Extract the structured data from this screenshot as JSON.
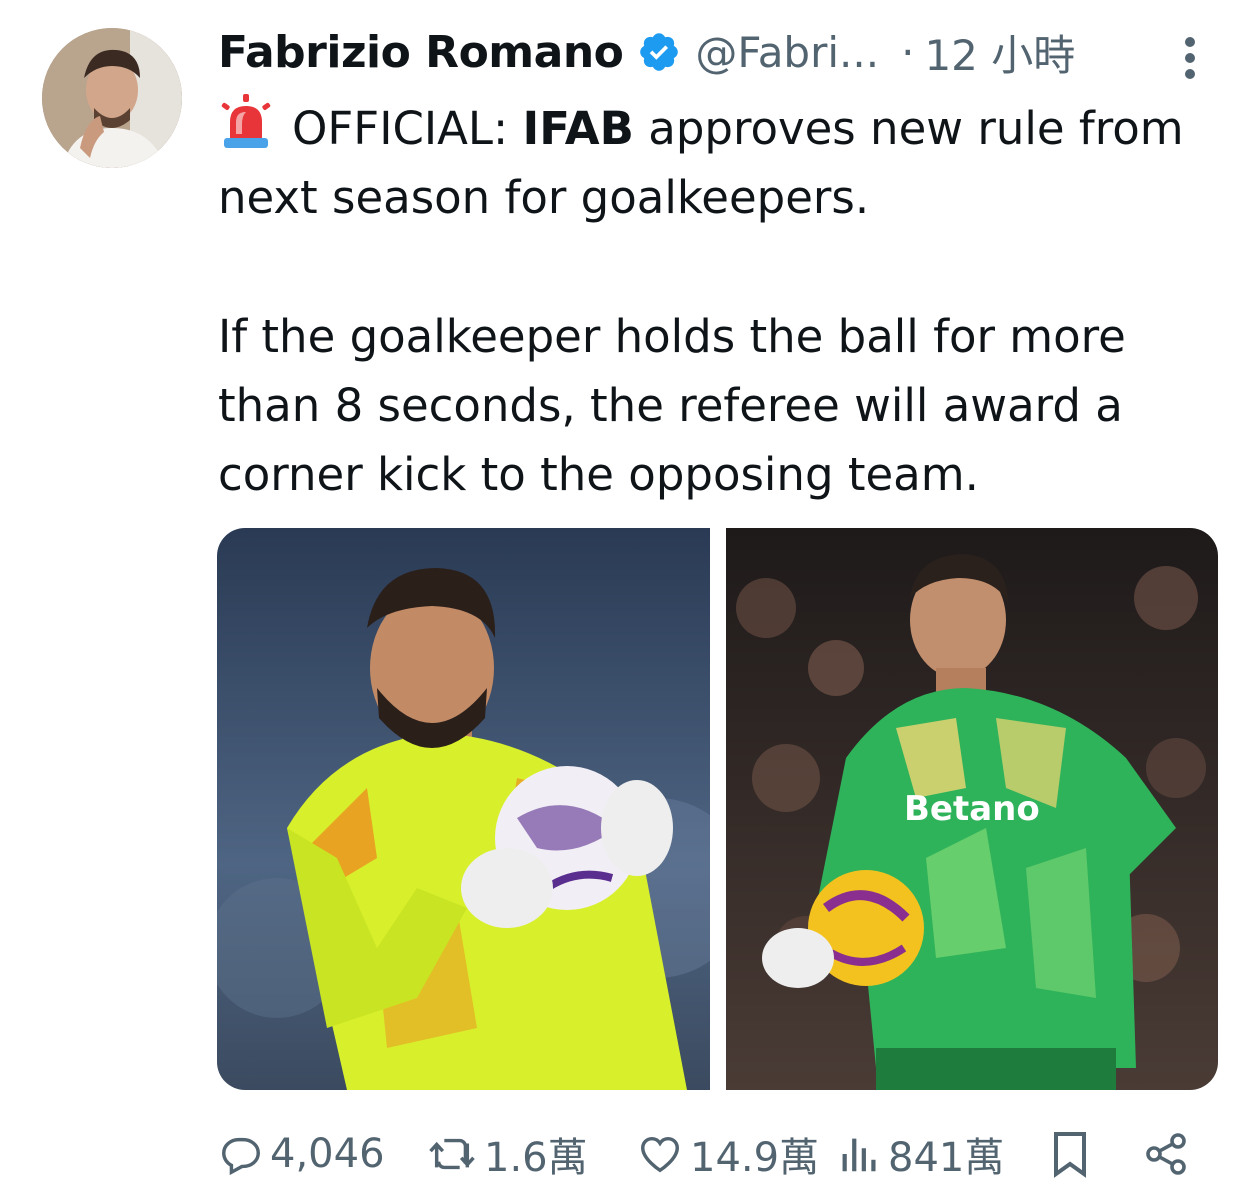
{
  "author": {
    "name": "Fabrizio Romano",
    "handle": "@Fabri...",
    "time_separator": "·",
    "time": "12 小時",
    "verified": true,
    "avatar_icon": "profile-photo"
  },
  "tweet": {
    "emoji": "siren-emoji",
    "line1_prefix": "OFFICIAL: ",
    "line1_bold": "IFAB",
    "line1_suffix": " approves new rule from next season for goalkeepers.",
    "paragraph2": "If the goalkeeper holds the ball for more than 8 seconds, the referee will award a corner kick to the opposing team."
  },
  "media": [
    {
      "subject": "goalkeeper-in-yellow-kit-holding-ball",
      "kit_color": "#d8f02c"
    },
    {
      "subject": "goalkeeper-in-green-kit-holding-ball",
      "kit_color": "#2fb35a",
      "sponsor_text": "Betano"
    }
  ],
  "actions": {
    "reply": {
      "icon": "reply-icon",
      "count": "4,046"
    },
    "repost": {
      "icon": "repost-icon",
      "count": "1.6萬"
    },
    "like": {
      "icon": "heart-icon",
      "count": "14.9萬"
    },
    "views": {
      "icon": "views-icon",
      "count": "841萬"
    },
    "bookmark": {
      "icon": "bookmark-icon"
    },
    "share": {
      "icon": "share-icon"
    }
  },
  "colors": {
    "text": "#0f1419",
    "secondary": "#536471",
    "verified": "#1d9bf0"
  }
}
